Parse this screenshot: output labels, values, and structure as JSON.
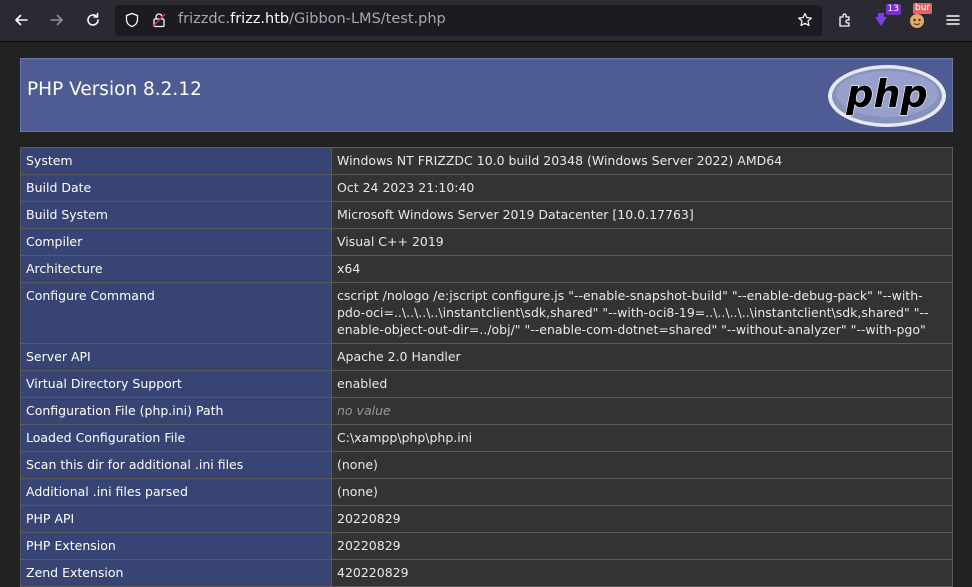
{
  "browser": {
    "url_host_prefix": "frizzdc.",
    "url_host": "frizz.htb",
    "url_path": "/Gibbon-LMS/test.php",
    "extension_badge": "13",
    "burp_badge": "bur"
  },
  "header": {
    "title": "PHP Version 8.2.12",
    "logo_text": "php"
  },
  "rows": [
    {
      "key": "System",
      "value": "Windows NT FRIZZDC 10.0 build 20348 (Windows Server 2022) AMD64"
    },
    {
      "key": "Build Date",
      "value": "Oct 24 2023 21:10:40"
    },
    {
      "key": "Build System",
      "value": "Microsoft Windows Server 2019 Datacenter [10.0.17763]"
    },
    {
      "key": "Compiler",
      "value": "Visual C++ 2019"
    },
    {
      "key": "Architecture",
      "value": "x64"
    },
    {
      "key": "Configure Command",
      "value": "cscript /nologo /e:jscript configure.js \"--enable-snapshot-build\" \"--enable-debug-pack\" \"--with-pdo-oci=..\\..\\..\\..\\instantclient\\sdk,shared\" \"--with-oci8-19=..\\..\\..\\..\\instantclient\\sdk,shared\" \"--enable-object-out-dir=../obj/\" \"--enable-com-dotnet=shared\" \"--without-analyzer\" \"--with-pgo\""
    },
    {
      "key": "Server API",
      "value": "Apache 2.0 Handler"
    },
    {
      "key": "Virtual Directory Support",
      "value": "enabled"
    },
    {
      "key": "Configuration File (php.ini) Path",
      "value": "no value"
    },
    {
      "key": "Loaded Configuration File",
      "value": "C:\\xampp\\php\\php.ini"
    },
    {
      "key": "Scan this dir for additional .ini files",
      "value": "(none)"
    },
    {
      "key": "Additional .ini files parsed",
      "value": "(none)"
    },
    {
      "key": "PHP API",
      "value": "20220829"
    },
    {
      "key": "PHP Extension",
      "value": "20220829"
    },
    {
      "key": "Zend Extension",
      "value": "420220829"
    }
  ]
}
